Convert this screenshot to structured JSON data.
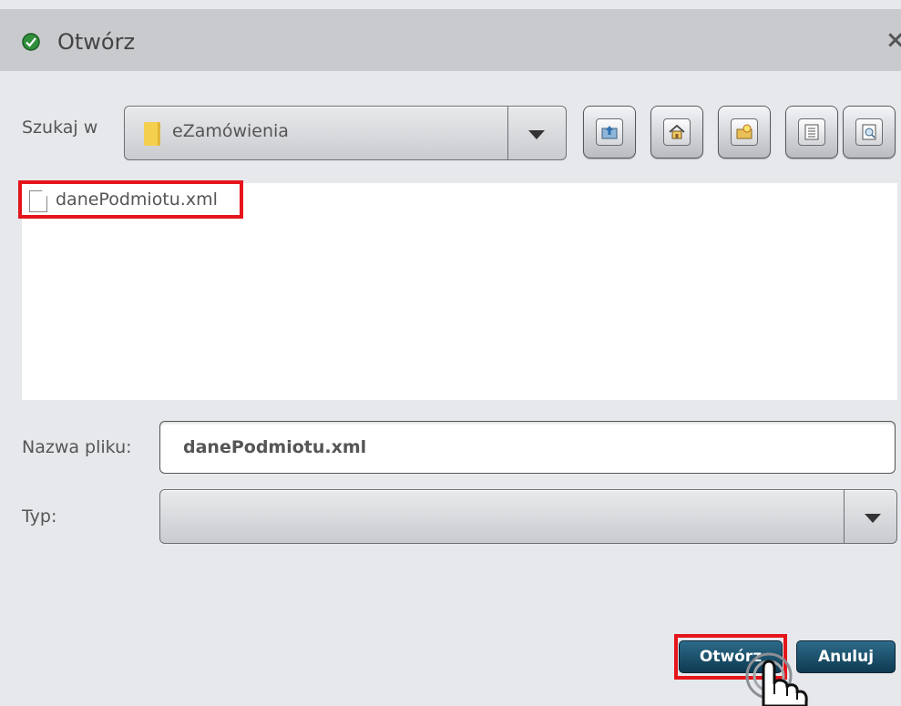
{
  "dialog": {
    "title": "Otwórz",
    "close_glyph": "×"
  },
  "look_in": {
    "label": "Szukaj w",
    "value": "eZamówienia",
    "folder_icon": "folder-icon"
  },
  "toolbar": {
    "buttons": [
      {
        "icon": "up-folder-icon"
      },
      {
        "icon": "home-icon"
      },
      {
        "icon": "new-folder-icon"
      },
      {
        "icon": "list-view-icon"
      },
      {
        "icon": "details-view-icon"
      }
    ]
  },
  "files": [
    {
      "name": "danePodmiotu.xml",
      "icon": "file-icon"
    }
  ],
  "filename": {
    "label": "Nazwa pliku:",
    "value": "danePodmiotu.xml"
  },
  "filetype": {
    "label": "Typ:",
    "value": ""
  },
  "actions": {
    "open_label": "Otwórz",
    "cancel_label": "Anuluj"
  },
  "colors": {
    "highlight": "#e5151b",
    "button": "#1b4d68"
  }
}
